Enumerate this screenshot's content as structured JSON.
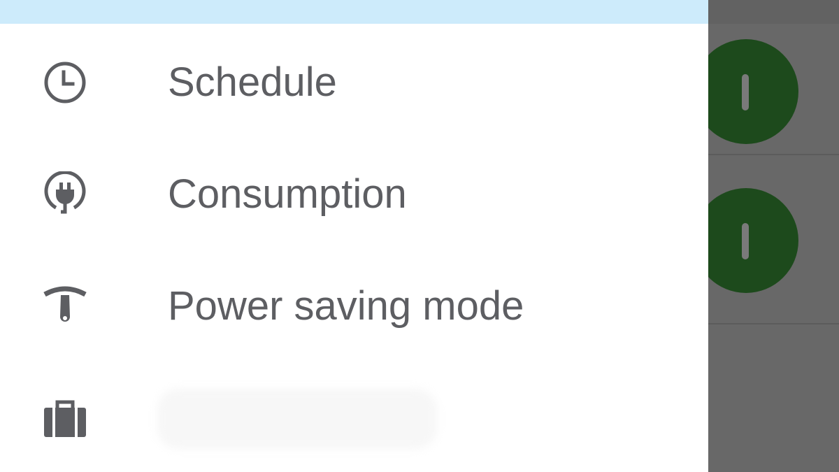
{
  "drawer": {
    "header_color": "#cdebfb",
    "items": [
      {
        "label": "Schedule",
        "icon": "clock-icon"
      },
      {
        "label": "Consumption",
        "icon": "plug-icon"
      },
      {
        "label": "Power saving mode",
        "icon": "gauge-icon"
      },
      {
        "label": "",
        "icon": "briefcase-icon",
        "label_obscured": true
      }
    ]
  },
  "background": {
    "toggle_color": "#1d4a1c",
    "toggles": [
      {
        "state": "on"
      },
      {
        "state": "on"
      }
    ]
  },
  "colors": {
    "text": "#5d5e62",
    "icon": "#5d5e62",
    "scrim": "#686868"
  }
}
